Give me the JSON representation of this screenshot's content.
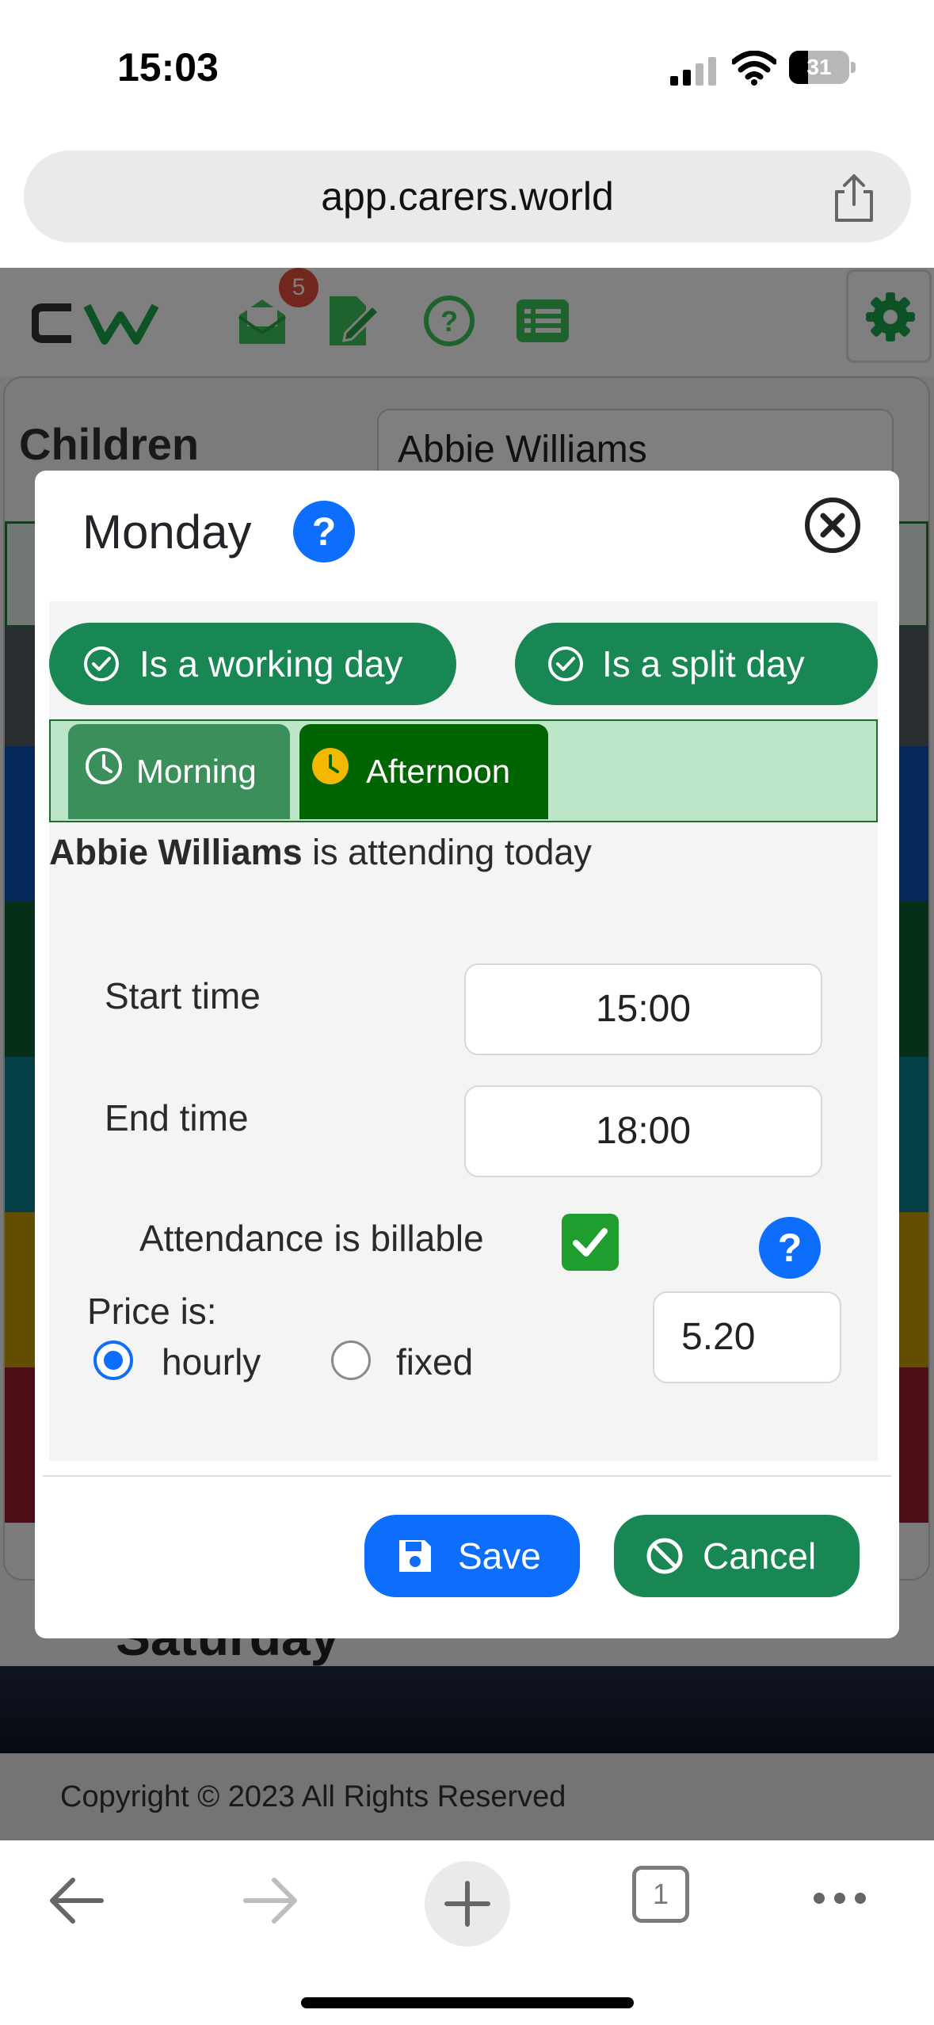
{
  "status_bar": {
    "time": "15:03",
    "battery_level": "31",
    "battery_fraction": 0.31
  },
  "browser": {
    "url": "app.carers.world",
    "open_tabs": "1"
  },
  "page": {
    "header": {
      "notification_count": "5",
      "logo_text": "CW"
    },
    "children_label": "Children",
    "selected_child": "Abbie Williams",
    "behind_modal_day": "Saturday",
    "day_band_colors": [
      "#0d4fb3",
      "#0d5e35",
      "#0a7f8f",
      "#c79a00",
      "#9b1f2a"
    ],
    "footer": "Copyright © 2023 All Rights Reserved"
  },
  "modal": {
    "title": "Monday",
    "toggles": {
      "working_day": "Is a working day",
      "split_day": "Is a split day"
    },
    "tabs": [
      {
        "label": "Morning",
        "active": false
      },
      {
        "label": "Afternoon",
        "active": true
      }
    ],
    "attendance": {
      "child_name": "Abbie Williams",
      "suffix": " is attending today"
    },
    "start_time": {
      "label": "Start time",
      "value": "15:00"
    },
    "end_time": {
      "label": "End time",
      "value": "18:00"
    },
    "billable": {
      "label": "Attendance is billable",
      "checked": true
    },
    "price": {
      "label": "Price is:",
      "options": [
        {
          "label": "hourly",
          "selected": true
        },
        {
          "label": "fixed",
          "selected": false
        }
      ],
      "value": "5.20"
    },
    "buttons": {
      "save": "Save",
      "cancel": "Cancel"
    },
    "help_glyph": "?"
  },
  "colors": {
    "primary": "#0d6efd",
    "success": "#198754",
    "tab_active": "#006400",
    "tab_inactive": "#3a8f5a",
    "clock_active": "#f5b800"
  }
}
